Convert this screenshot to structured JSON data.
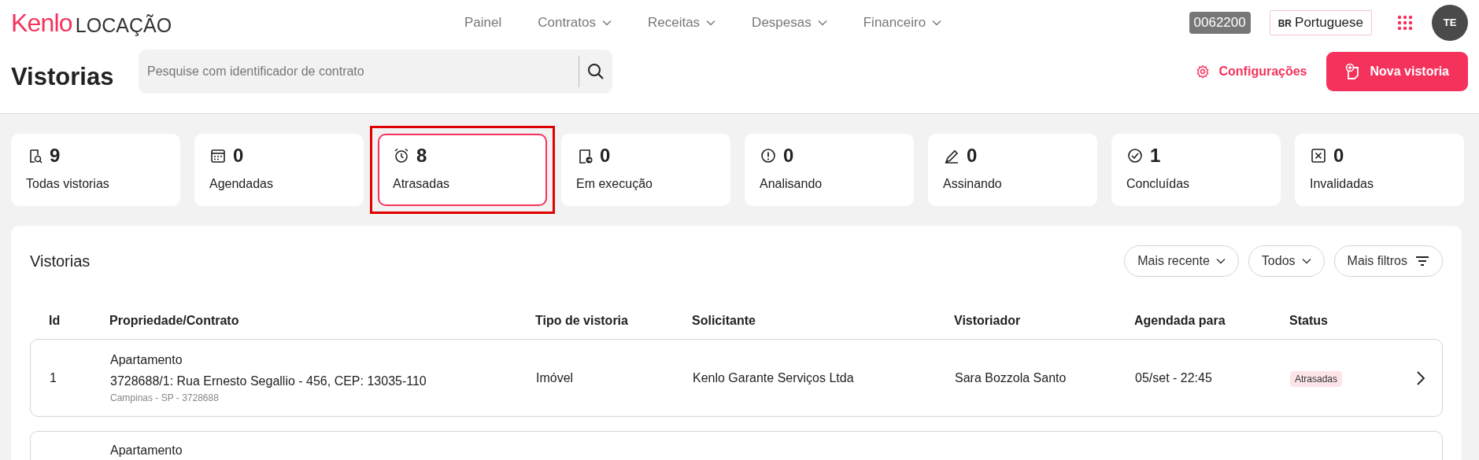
{
  "brand": {
    "name": "Kenlo",
    "product": "LOCAÇÃO"
  },
  "nav": [
    {
      "label": "Painel",
      "dropdown": false
    },
    {
      "label": "Contratos",
      "dropdown": true
    },
    {
      "label": "Receitas",
      "dropdown": true
    },
    {
      "label": "Despesas",
      "dropdown": true
    },
    {
      "label": "Financeiro",
      "dropdown": true
    }
  ],
  "account_code": "0062200",
  "language": {
    "flag": "BR",
    "label": "Portuguese"
  },
  "avatar": "TE",
  "page_title": "Vistorias",
  "search": {
    "placeholder": "Pesquise com identificador de contrato"
  },
  "settings_link": "Configurações",
  "new_button": "Nova vistoria",
  "status_cards": [
    {
      "count": "9",
      "label": "Todas vistorias",
      "selected": false,
      "highlighted": false
    },
    {
      "count": "0",
      "label": "Agendadas",
      "selected": false,
      "highlighted": false
    },
    {
      "count": "8",
      "label": "Atrasadas",
      "selected": true,
      "highlighted": true
    },
    {
      "count": "0",
      "label": "Em execução",
      "selected": false,
      "highlighted": false
    },
    {
      "count": "0",
      "label": "Analisando",
      "selected": false,
      "highlighted": false
    },
    {
      "count": "0",
      "label": "Assinando",
      "selected": false,
      "highlighted": false
    },
    {
      "count": "1",
      "label": "Concluídas",
      "selected": false,
      "highlighted": false
    },
    {
      "count": "0",
      "label": "Invalidadas",
      "selected": false,
      "highlighted": false
    }
  ],
  "list": {
    "title": "Vistorias",
    "filters": [
      {
        "label": "Mais recente",
        "kind": "dropdown"
      },
      {
        "label": "Todos",
        "kind": "dropdown"
      },
      {
        "label": "Mais filtros",
        "kind": "filter"
      }
    ],
    "columns": [
      "Id",
      "Propriedade/Contrato",
      "Tipo de vistoria",
      "Solicitante",
      "Vistoriador",
      "Agendada para",
      "Status"
    ],
    "rows": [
      {
        "id": "1",
        "property_type": "Apartamento",
        "address": "3728688/1: Rua Ernesto Segallio - 456, CEP: 13035-110",
        "location": "Campinas - SP - 3728688",
        "type": "Imóvel",
        "requester": "Kenlo Garante Serviços Ltda",
        "inspector": "Sara Bozzola Santo",
        "scheduled": "05/set - 22:45",
        "status": "Atrasadas"
      },
      {
        "property_type": "Apartamento"
      }
    ]
  }
}
